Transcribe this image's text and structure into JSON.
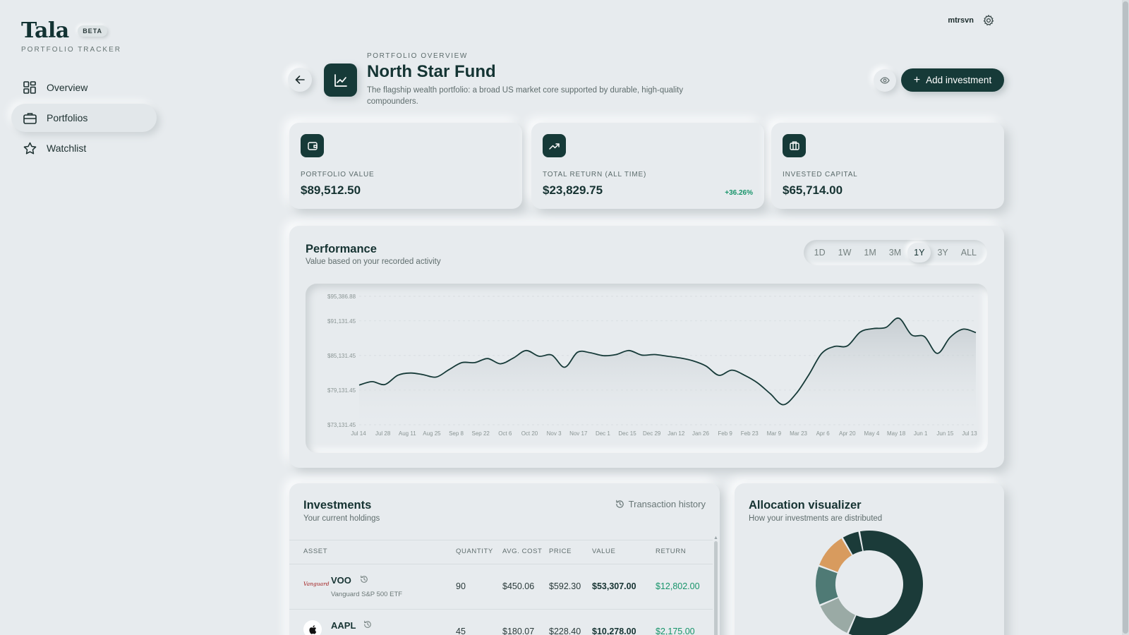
{
  "brand": {
    "name": "Tala",
    "badge": "BETA",
    "tagline": "PORTFOLIO TRACKER"
  },
  "nav": [
    {
      "label": "Overview",
      "icon": "grid-icon",
      "active": false
    },
    {
      "label": "Portfolios",
      "icon": "briefcase-icon",
      "active": true
    },
    {
      "label": "Watchlist",
      "icon": "star-icon",
      "active": false
    }
  ],
  "user": {
    "name": "mtrsvn"
  },
  "header": {
    "kicker": "PORTFOLIO OVERVIEW",
    "title": "North Star Fund",
    "description": "The flagship wealth portfolio: a broad US market core supported by durable, high-quality compounders.",
    "add_label": "Add investment"
  },
  "stats": [
    {
      "label": "PORTFOLIO VALUE",
      "value": "$89,512.50",
      "icon": "wallet-icon"
    },
    {
      "label": "TOTAL RETURN (ALL TIME)",
      "value": "$23,829.75",
      "change": "+36.26%",
      "icon": "trend-up-icon"
    },
    {
      "label": "INVESTED CAPITAL",
      "value": "$65,714.00",
      "icon": "briefcase-icon"
    }
  ],
  "performance": {
    "title": "Performance",
    "subtitle": "Value based on your recorded activity",
    "ranges": [
      "1D",
      "1W",
      "1M",
      "3M",
      "1Y",
      "3Y",
      "ALL"
    ],
    "active_range": "1Y"
  },
  "chart_data": {
    "type": "area",
    "y_ticks": [
      "$95,386.88",
      "$91,131.45",
      "$85,131.45",
      "$79,131.45",
      "$73,131.45"
    ],
    "ylim": [
      73131.45,
      95386.88
    ],
    "grid": true,
    "x_ticks": [
      "Jul 14",
      "Jul 28",
      "Aug 11",
      "Aug 25",
      "Sep 8",
      "Sep 22",
      "Oct 6",
      "Oct 20",
      "Nov 3",
      "Nov 17",
      "Dec 1",
      "Dec 15",
      "Dec 29",
      "Jan 12",
      "Jan 26",
      "Feb 9",
      "Feb 23",
      "Mar 9",
      "Mar 23",
      "Apr 6",
      "Apr 20",
      "May 4",
      "May 18",
      "Jun 1",
      "Jun 15",
      "Jul 13"
    ],
    "series": [
      {
        "values": [
          80000,
          80600,
          80100,
          81700,
          82100,
          81800,
          81400,
          82700,
          83900,
          83900,
          84600,
          83700,
          84700,
          86000,
          85000,
          85200,
          83100,
          85700,
          85600,
          85100,
          85300,
          86000,
          85200,
          85300,
          85000,
          84700,
          84200,
          83300,
          81700,
          82600,
          81700,
          80400,
          78500,
          76600,
          78500,
          81800,
          85500,
          86700,
          86800,
          89200,
          89800,
          90000,
          91600,
          88700,
          88400,
          85500,
          88300,
          89700,
          89100
        ]
      }
    ]
  },
  "investments": {
    "title": "Investments",
    "subtitle": "Your current holdings",
    "history_label": "Transaction history",
    "columns": [
      "ASSET",
      "QUANTITY",
      "AVG. COST",
      "PRICE",
      "VALUE",
      "RETURN"
    ],
    "rows": [
      {
        "symbol": "VOO",
        "name": "Vanguard S&P 500 ETF",
        "logo": "Vanguard",
        "quantity": "90",
        "avg_cost": "$450.06",
        "price": "$592.30",
        "value": "$53,307.00",
        "return": "$12,802.00"
      },
      {
        "symbol": "AAPL",
        "name": "",
        "logo": "apple-logo",
        "quantity": "45",
        "avg_cost": "$180.07",
        "price": "$228.40",
        "value": "$10,278.00",
        "return": "$2,175.00"
      }
    ]
  },
  "allocation": {
    "title": "Allocation visualizer",
    "subtitle": "How your investments are distributed",
    "segments": [
      {
        "label": "VOO",
        "fraction": 0.596,
        "color": "#1b3b39"
      },
      {
        "label": "segment-2",
        "fraction": 0.12,
        "color": "#9aaaa5"
      },
      {
        "label": "segment-3",
        "fraction": 0.12,
        "color": "#4f7a75"
      },
      {
        "label": "segment-4",
        "fraction": 0.11,
        "color": "#d89b5e"
      },
      {
        "label": "segment-5",
        "fraction": 0.054,
        "color": "#1b3b39"
      }
    ]
  }
}
